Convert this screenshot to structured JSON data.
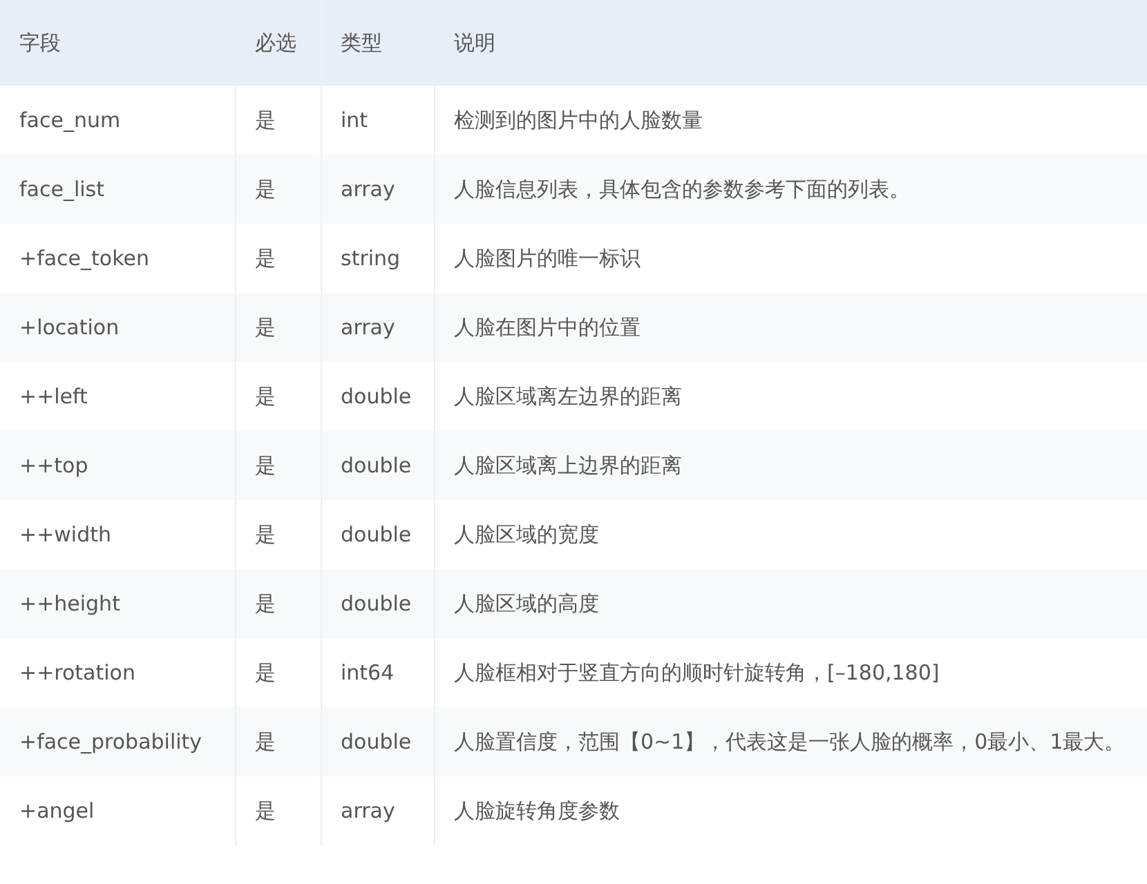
{
  "table": {
    "columns": [
      "字段",
      "必选",
      "类型",
      "说明"
    ],
    "rows": [
      [
        "face_num",
        "是",
        "int",
        "检测到的图片中的人脸数量"
      ],
      [
        "face_list",
        "是",
        "array",
        "人脸信息列表，具体包含的参数参考下面的列表。"
      ],
      [
        "+face_token",
        "是",
        "string",
        "人脸图片的唯一标识"
      ],
      [
        "+location",
        "是",
        "array",
        "人脸在图片中的位置"
      ],
      [
        "++left",
        "是",
        "double",
        "人脸区域离左边界的距离"
      ],
      [
        "++top",
        "是",
        "double",
        "人脸区域离上边界的距离"
      ],
      [
        "++width",
        "是",
        "double",
        "人脸区域的宽度"
      ],
      [
        "++height",
        "是",
        "double",
        "人脸区域的高度"
      ],
      [
        "++rotation",
        "是",
        "int64",
        "人脸框相对于竖直方向的顺时针旋转角，[–180,180]"
      ],
      [
        "+face_probability",
        "是",
        "double",
        "人脸置信度，范围【0~1】，代表这是一张人脸的概率，0最小、1最大。"
      ],
      [
        "+angel",
        "是",
        "array",
        "人脸旋转角度参数"
      ]
    ]
  }
}
